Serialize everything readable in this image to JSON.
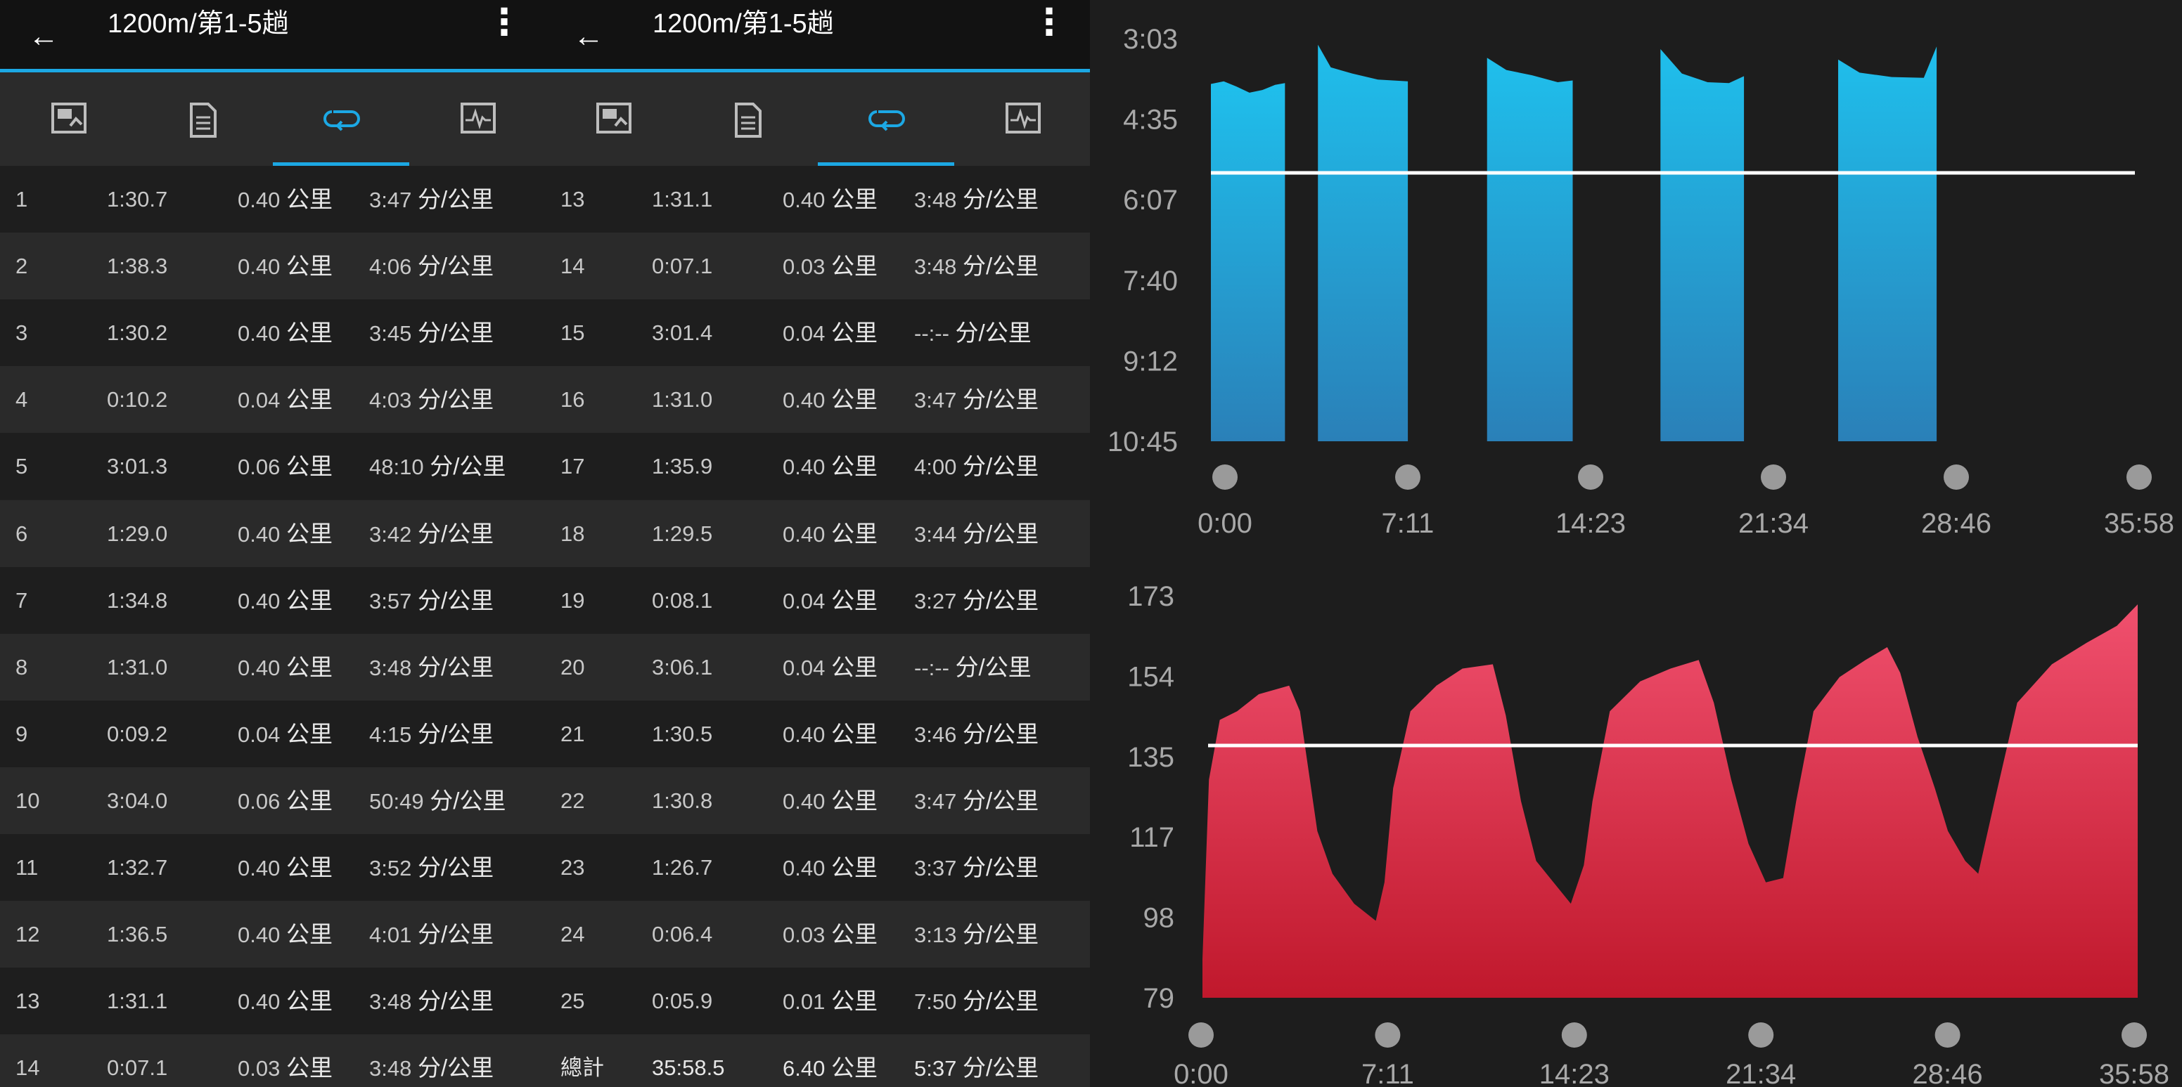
{
  "screens": [
    {
      "title": "1200m/第1-5趟",
      "rows": [
        {
          "idx": "1",
          "time": "1:30.7",
          "dist": "0.40",
          "pace": "3:47"
        },
        {
          "idx": "2",
          "time": "1:38.3",
          "dist": "0.40",
          "pace": "4:06"
        },
        {
          "idx": "3",
          "time": "1:30.2",
          "dist": "0.40",
          "pace": "3:45"
        },
        {
          "idx": "4",
          "time": "0:10.2",
          "dist": "0.04",
          "pace": "4:03"
        },
        {
          "idx": "5",
          "time": "3:01.3",
          "dist": "0.06",
          "pace": "48:10"
        },
        {
          "idx": "6",
          "time": "1:29.0",
          "dist": "0.40",
          "pace": "3:42"
        },
        {
          "idx": "7",
          "time": "1:34.8",
          "dist": "0.40",
          "pace": "3:57"
        },
        {
          "idx": "8",
          "time": "1:31.0",
          "dist": "0.40",
          "pace": "3:48"
        },
        {
          "idx": "9",
          "time": "0:09.2",
          "dist": "0.04",
          "pace": "4:15"
        },
        {
          "idx": "10",
          "time": "3:04.0",
          "dist": "0.06",
          "pace": "50:49"
        },
        {
          "idx": "11",
          "time": "1:32.7",
          "dist": "0.40",
          "pace": "3:52"
        },
        {
          "idx": "12",
          "time": "1:36.5",
          "dist": "0.40",
          "pace": "4:01"
        },
        {
          "idx": "13",
          "time": "1:31.1",
          "dist": "0.40",
          "pace": "3:48"
        },
        {
          "idx": "14",
          "time": "0:07.1",
          "dist": "0.03",
          "pace": "3:48"
        }
      ]
    },
    {
      "title": "1200m/第1-5趟",
      "rows": [
        {
          "idx": "13",
          "time": "1:31.1",
          "dist": "0.40",
          "pace": "3:48"
        },
        {
          "idx": "14",
          "time": "0:07.1",
          "dist": "0.03",
          "pace": "3:48"
        },
        {
          "idx": "15",
          "time": "3:01.4",
          "dist": "0.04",
          "pace": "--:--"
        },
        {
          "idx": "16",
          "time": "1:31.0",
          "dist": "0.40",
          "pace": "3:47"
        },
        {
          "idx": "17",
          "time": "1:35.9",
          "dist": "0.40",
          "pace": "4:00"
        },
        {
          "idx": "18",
          "time": "1:29.5",
          "dist": "0.40",
          "pace": "3:44"
        },
        {
          "idx": "19",
          "time": "0:08.1",
          "dist": "0.04",
          "pace": "3:27"
        },
        {
          "idx": "20",
          "time": "3:06.1",
          "dist": "0.04",
          "pace": "--:--"
        },
        {
          "idx": "21",
          "time": "1:30.5",
          "dist": "0.40",
          "pace": "3:46"
        },
        {
          "idx": "22",
          "time": "1:30.8",
          "dist": "0.40",
          "pace": "3:47"
        },
        {
          "idx": "23",
          "time": "1:26.7",
          "dist": "0.40",
          "pace": "3:37"
        },
        {
          "idx": "24",
          "time": "0:06.4",
          "dist": "0.03",
          "pace": "3:13"
        },
        {
          "idx": "25",
          "time": "0:05.9",
          "dist": "0.01",
          "pace": "7:50"
        },
        {
          "idx": "總計",
          "time": "35:58.5",
          "dist": "6.40",
          "pace": "5:37"
        }
      ]
    }
  ],
  "units": {
    "distance": "公里",
    "pace": "分/公里"
  },
  "icons": {
    "back": "arrow-left-icon",
    "more": "more-vert-icon",
    "tabs": [
      "photo-card-icon",
      "document-icon",
      "laps-loop-icon",
      "activity-graph-icon"
    ]
  },
  "colors": {
    "accent": "#1ca8e4",
    "pace_top": "#1fbfec",
    "pace_bottom": "#2a80b8",
    "hr_top": "#f0506e",
    "hr_bottom": "#c0182c",
    "average_line": "#ffffff"
  },
  "chart_data": [
    {
      "type": "area",
      "metric": "pace",
      "y_axis_reversed": true,
      "y_ticks": [
        "3:03",
        "4:35",
        "6:07",
        "7:40",
        "9:12",
        "10:45"
      ],
      "x_ticks": [
        "0:00",
        "7:11",
        "14:23",
        "21:34",
        "28:46",
        "35:58"
      ],
      "ylim_seconds": [
        183,
        645
      ],
      "xlim_seconds": [
        0,
        2158
      ],
      "average_pace": "5:37",
      "segments": [
        {
          "start": "0:00",
          "end": "2:53",
          "points": [
            [
              "0:00",
              "3:55"
            ],
            [
              "0:30",
              "3:52"
            ],
            [
              "1:00",
              "3:58"
            ],
            [
              "1:30",
              "4:05"
            ],
            [
              "2:00",
              "4:02"
            ],
            [
              "2:30",
              "3:56"
            ],
            [
              "2:53",
              "3:54"
            ]
          ]
        },
        {
          "start": "4:10",
          "end": "7:40",
          "points": [
            [
              "4:10",
              "3:10"
            ],
            [
              "4:40",
              "3:36"
            ],
            [
              "5:30",
              "3:43"
            ],
            [
              "6:30",
              "3:50"
            ],
            [
              "7:40",
              "3:52"
            ]
          ]
        },
        {
          "start": "10:45",
          "end": "14:05",
          "points": [
            [
              "10:45",
              "3:25"
            ],
            [
              "11:30",
              "3:39"
            ],
            [
              "12:30",
              "3:45"
            ],
            [
              "13:30",
              "3:53"
            ],
            [
              "14:05",
              "3:51"
            ]
          ]
        },
        {
          "start": "17:30",
          "end": "20:45",
          "points": [
            [
              "17:30",
              "3:15"
            ],
            [
              "18:20",
              "3:43"
            ],
            [
              "19:20",
              "3:53"
            ],
            [
              "20:10",
              "3:54"
            ],
            [
              "20:45",
              "3:46"
            ]
          ]
        },
        {
          "start": "24:25",
          "end": "28:15",
          "points": [
            [
              "24:25",
              "3:27"
            ],
            [
              "25:15",
              "3:42"
            ],
            [
              "26:30",
              "3:47"
            ],
            [
              "27:45",
              "3:48"
            ],
            [
              "28:15",
              "3:12"
            ]
          ]
        }
      ]
    },
    {
      "type": "area",
      "metric": "heart_rate",
      "y_ticks": [
        "173",
        "154",
        "135",
        "117",
        "98",
        "79"
      ],
      "x_ticks": [
        "0:00",
        "7:11",
        "14:23",
        "21:34",
        "28:46",
        "35:58"
      ],
      "ylim": [
        79,
        173
      ],
      "average": 138,
      "points": [
        [
          "0:00",
          88
        ],
        [
          "0:15",
          130
        ],
        [
          "0:40",
          144
        ],
        [
          "1:20",
          146
        ],
        [
          "2:10",
          150
        ],
        [
          "3:20",
          152
        ],
        [
          "3:45",
          146
        ],
        [
          "4:25",
          118
        ],
        [
          "5:00",
          108
        ],
        [
          "5:50",
          101
        ],
        [
          "6:40",
          97
        ],
        [
          "7:00",
          106
        ],
        [
          "7:20",
          128
        ],
        [
          "8:00",
          146
        ],
        [
          "9:00",
          152
        ],
        [
          "10:00",
          156
        ],
        [
          "11:10",
          157
        ],
        [
          "11:40",
          145
        ],
        [
          "12:15",
          125
        ],
        [
          "12:50",
          111
        ],
        [
          "13:30",
          106
        ],
        [
          "14:10",
          101
        ],
        [
          "14:40",
          110
        ],
        [
          "15:00",
          125
        ],
        [
          "15:40",
          146
        ],
        [
          "16:50",
          153
        ],
        [
          "18:00",
          156
        ],
        [
          "19:05",
          158
        ],
        [
          "19:40",
          148
        ],
        [
          "20:20",
          130
        ],
        [
          "21:00",
          115
        ],
        [
          "21:40",
          106
        ],
        [
          "22:20",
          107
        ],
        [
          "22:50",
          125
        ],
        [
          "23:30",
          146
        ],
        [
          "24:30",
          154
        ],
        [
          "25:30",
          158
        ],
        [
          "26:20",
          161
        ],
        [
          "26:50",
          155
        ],
        [
          "27:30",
          140
        ],
        [
          "28:10",
          128
        ],
        [
          "28:40",
          118
        ],
        [
          "29:20",
          111
        ],
        [
          "29:50",
          108
        ],
        [
          "30:30",
          126
        ],
        [
          "31:20",
          148
        ],
        [
          "32:40",
          157
        ],
        [
          "34:00",
          162
        ],
        [
          "35:10",
          166
        ],
        [
          "35:58",
          171
        ]
      ]
    }
  ]
}
